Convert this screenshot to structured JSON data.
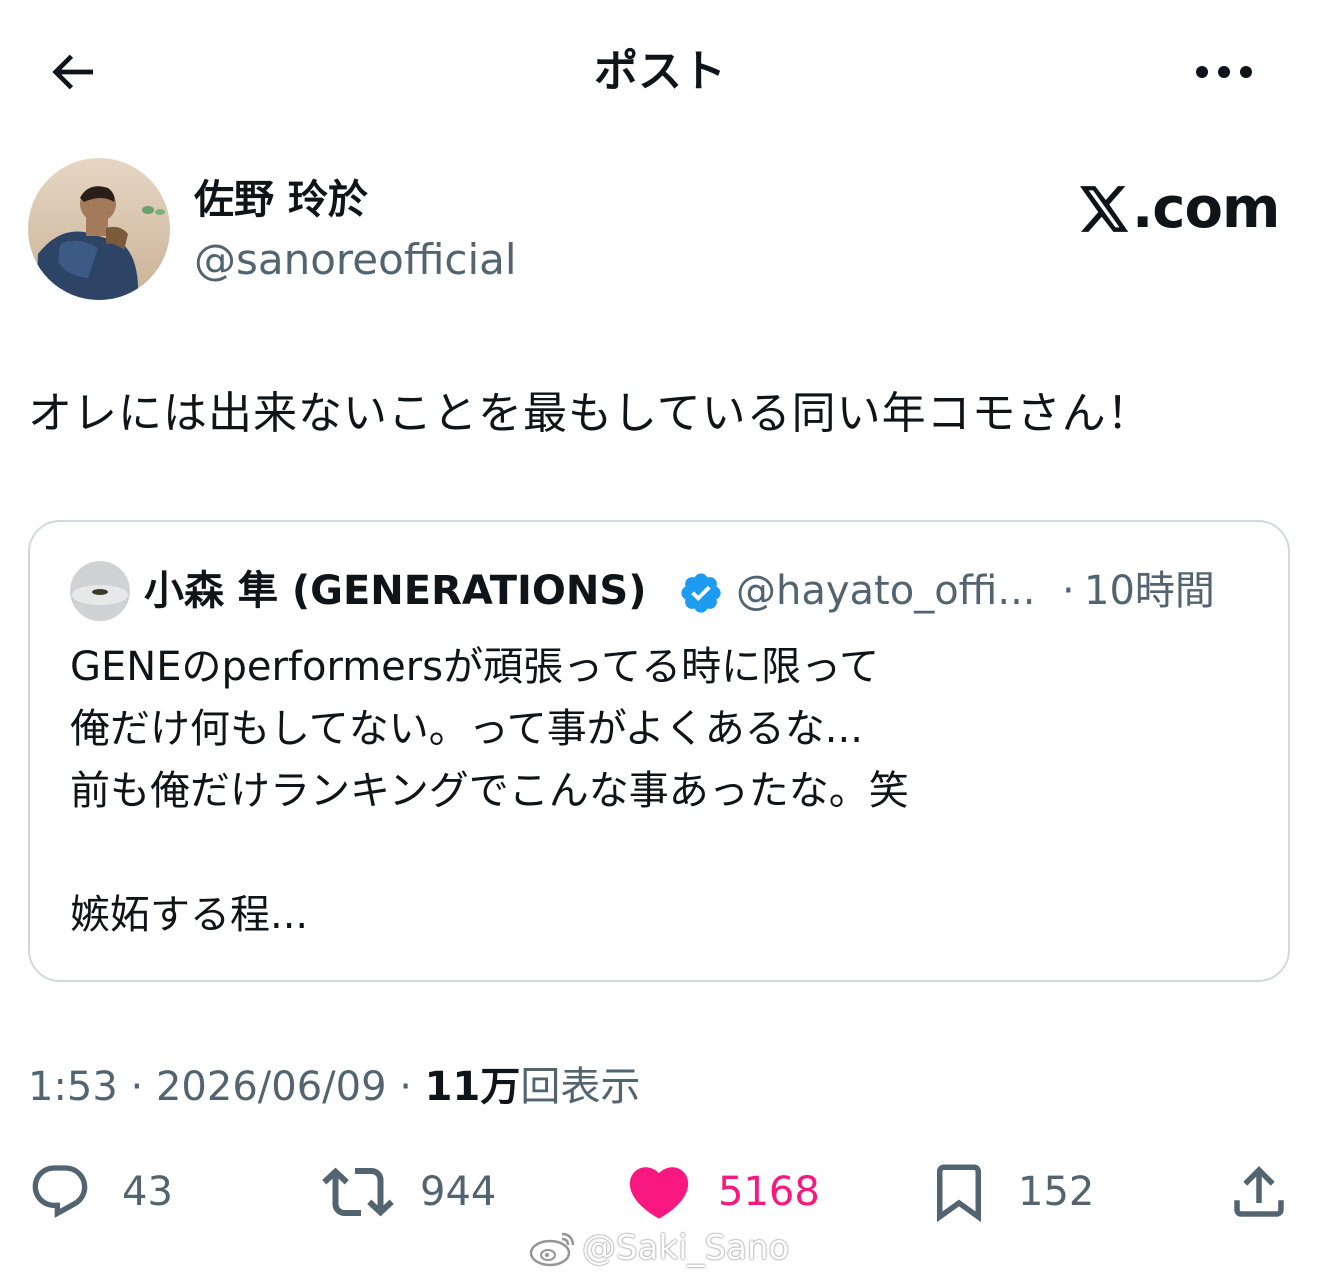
{
  "header": {
    "title": "ポスト",
    "back_icon": "arrow-left-icon",
    "more_icon": "more-horizontal-icon"
  },
  "post": {
    "author_name": "佐野 玲於",
    "author_handle": "@sanoreofficial",
    "source_logo_text": ".com",
    "text": "オレには出来ないことを最もしている同い年コモさん！",
    "timestamp": "1:53 · 2026/06/09 · ",
    "views_count": "11万",
    "views_label": "回表示"
  },
  "quote": {
    "author_name": "小森 隼 (GENERATIONS)",
    "author_handle": "@hayato_offi...",
    "separator": "·",
    "time": "10時間",
    "lines": [
      "GENEのperformersが頑張ってる時に限って",
      "俺だけ何もしてない。って事がよくあるな...",
      "前も俺だけランキングでこんな事あったな。笑",
      "",
      "嫉妬する程..."
    ]
  },
  "actions": {
    "replies": "43",
    "reposts": "944",
    "likes": "5168",
    "bookmarks": "152"
  },
  "watermark": "@Saki_Sano",
  "colors": {
    "text_primary": "#0f1419",
    "text_secondary": "#536471",
    "like_pink": "#f91880",
    "verified_blue": "#1d9bf0",
    "border": "#cfd9de"
  }
}
